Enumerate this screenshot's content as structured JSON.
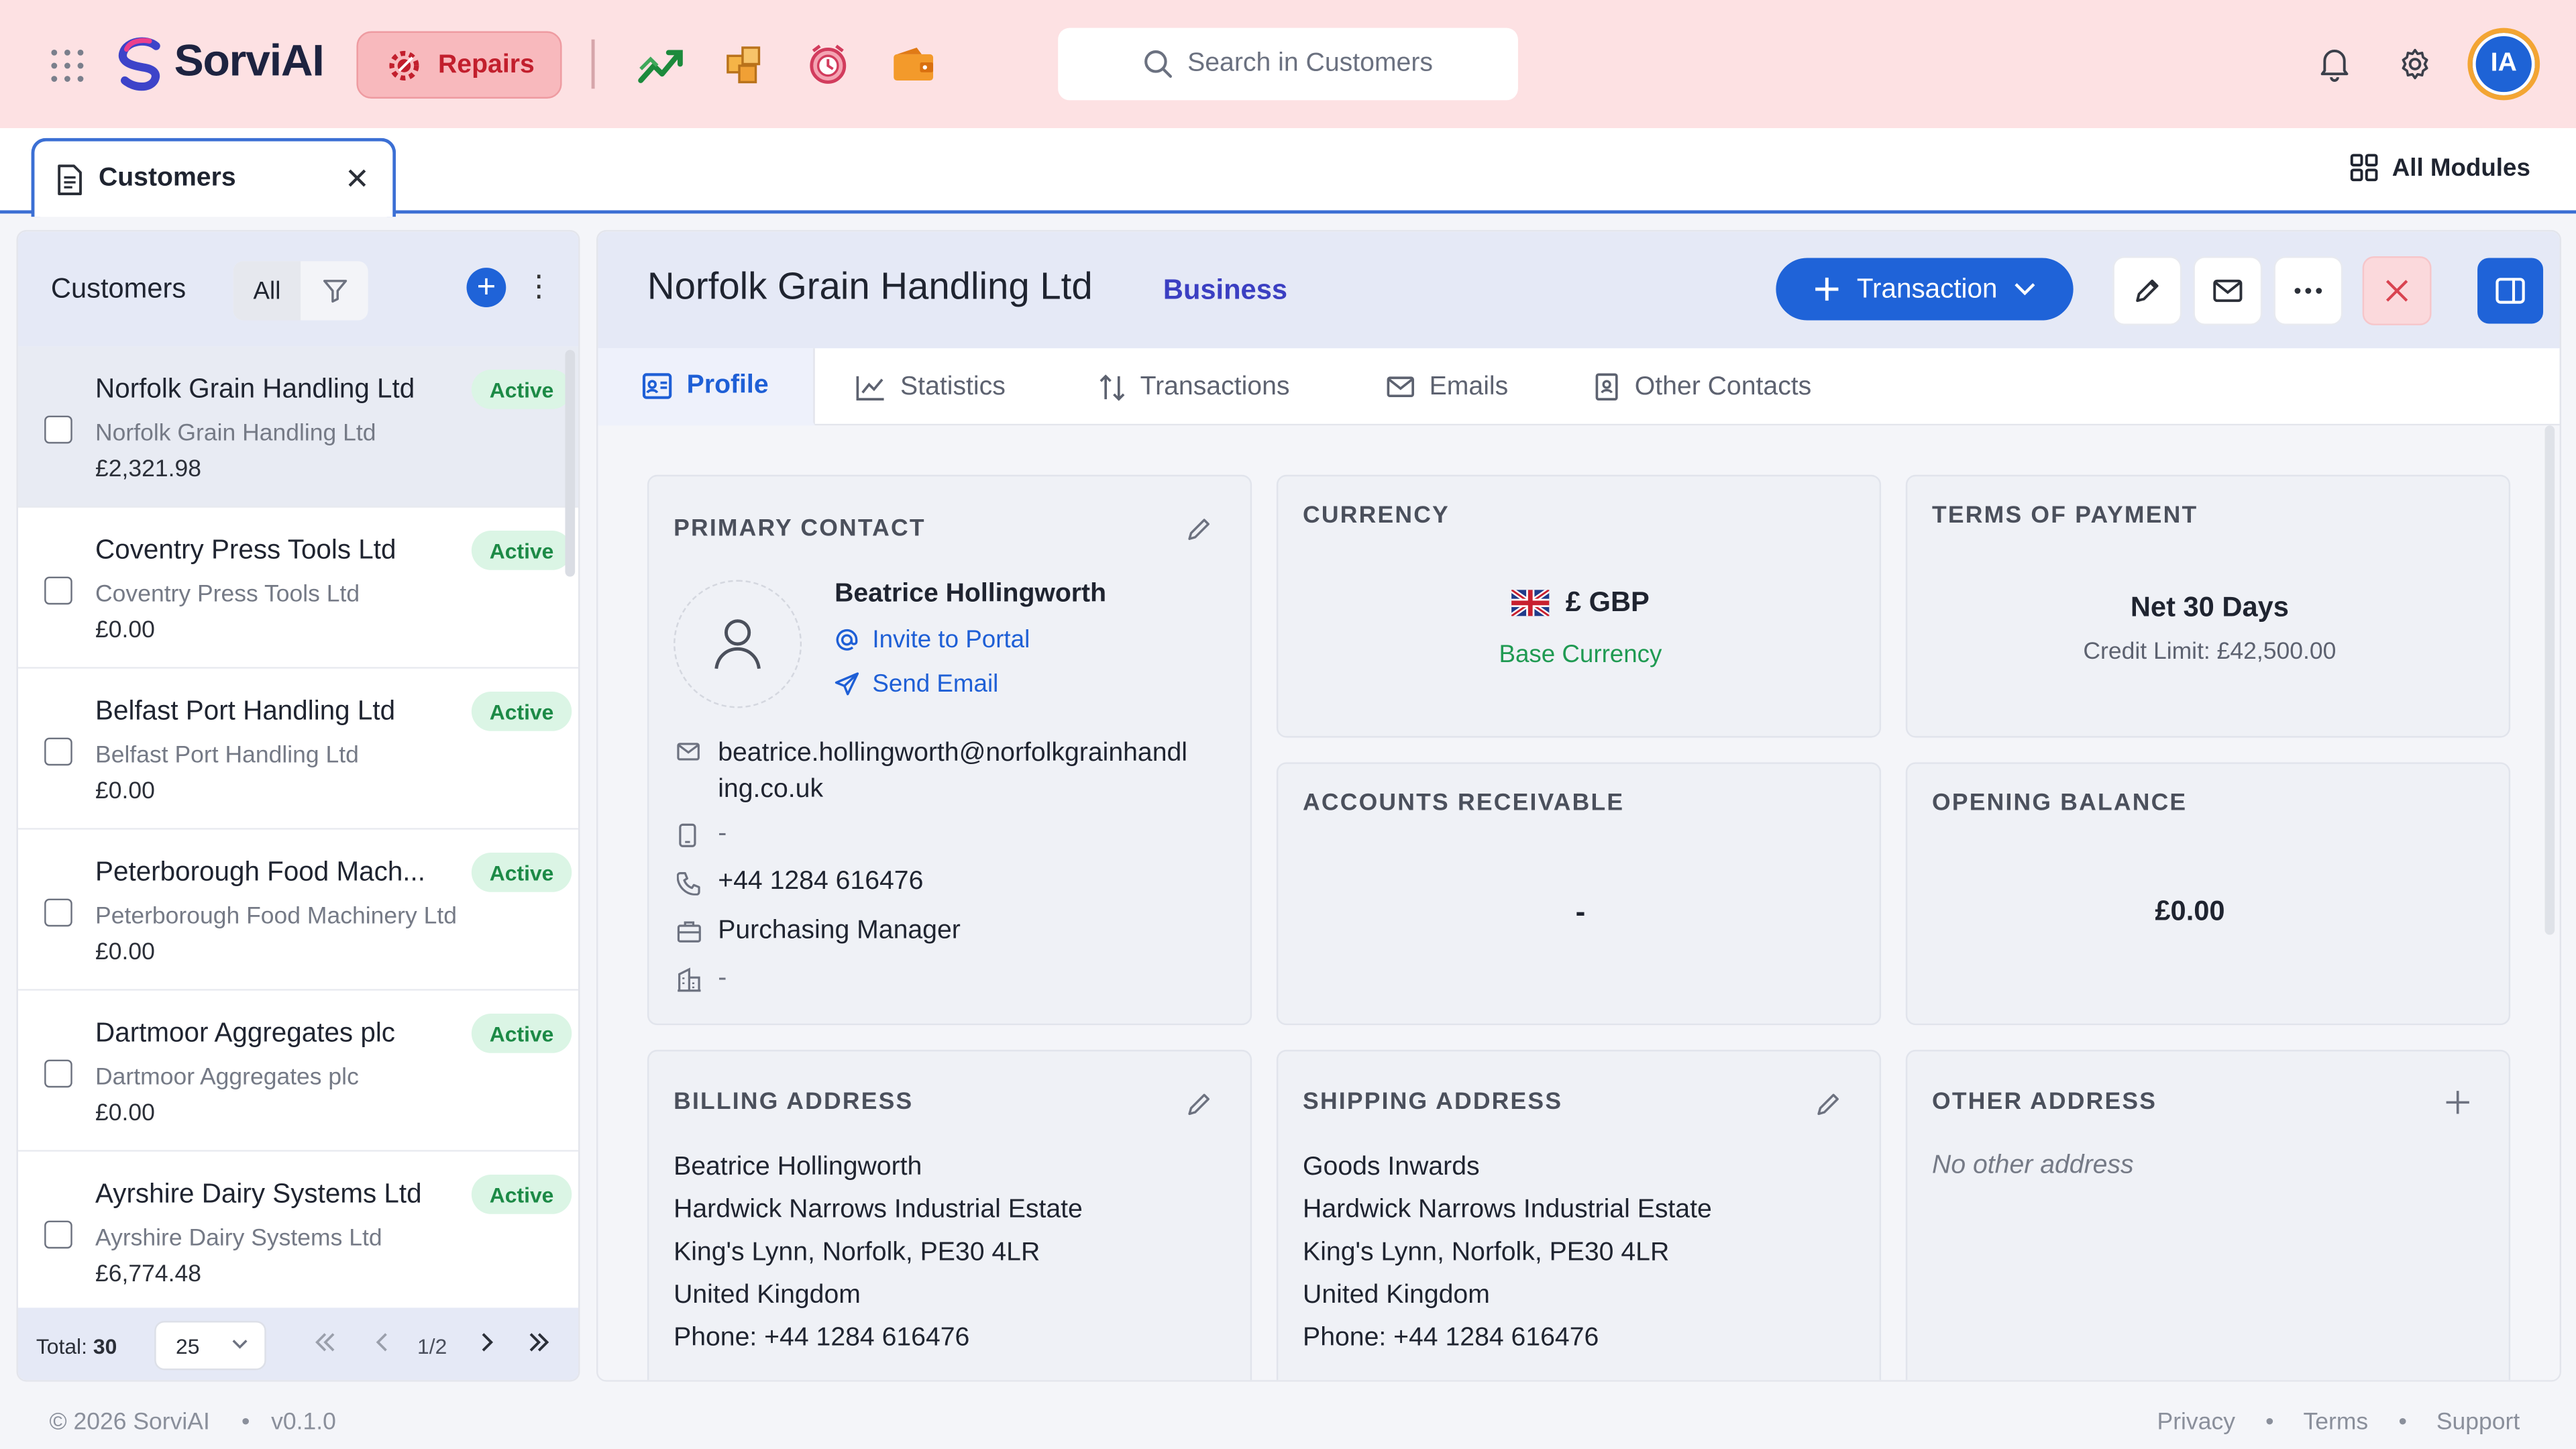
{
  "app": {
    "name": "SorviAI",
    "module_button": "Repairs",
    "search_placeholder": "Search in Customers",
    "user_initials": "IA",
    "brand_color": "#1f63d8",
    "accent_color": "#fde1e3"
  },
  "topbar_icons": [
    "apps-grid-icon",
    "growth-chart-icon",
    "boxes-icon",
    "alarm-clock-icon",
    "wallet-icon",
    "bell-icon",
    "gear-icon"
  ],
  "tabstrip": {
    "tab_label": "Customers",
    "all_modules": "All Modules"
  },
  "list": {
    "title": "Customers",
    "filter_all": "All",
    "items": [
      {
        "name": "Norfolk Grain Handling Ltd",
        "company": "Norfolk Grain Handling Ltd",
        "amount": "£2,321.98",
        "status": "Active"
      },
      {
        "name": "Coventry Press Tools Ltd",
        "company": "Coventry Press Tools Ltd",
        "amount": "£0.00",
        "status": "Active"
      },
      {
        "name": "Belfast Port Handling Ltd",
        "company": "Belfast Port Handling Ltd",
        "amount": "£0.00",
        "status": "Active"
      },
      {
        "name": "Peterborough Food Mach...",
        "company": "Peterborough Food Machinery Ltd",
        "amount": "£0.00",
        "status": "Active"
      },
      {
        "name": "Dartmoor Aggregates plc",
        "company": "Dartmoor Aggregates plc",
        "amount": "£0.00",
        "status": "Active"
      },
      {
        "name": "Ayrshire Dairy Systems Ltd",
        "company": "Ayrshire Dairy Systems Ltd",
        "amount": "£6,774.48",
        "status": "Active"
      }
    ],
    "footer": {
      "total_label": "Total:",
      "total_value": "30",
      "page_size": "25",
      "page_indicator": "1/2"
    }
  },
  "detail": {
    "title": "Norfolk Grain Handling Ltd",
    "type": "Business",
    "transaction_button": "Transaction",
    "tabs": [
      "Profile",
      "Statistics",
      "Transactions",
      "Emails",
      "Other Contacts"
    ],
    "primary_contact": {
      "heading": "PRIMARY CONTACT",
      "name": "Beatrice Hollingworth",
      "invite": "Invite to Portal",
      "send_email": "Send Email",
      "email_line1": "beatrice.hollingworth@norfolkgrainhandl",
      "email_line2": "ing.co.uk",
      "mobile": "-",
      "phone": "+44 1284 616476",
      "job_title": "Purchasing Manager",
      "department": "-"
    },
    "currency": {
      "heading": "CURRENCY",
      "value": "£ GBP",
      "note": "Base Currency"
    },
    "terms": {
      "heading": "TERMS OF PAYMENT",
      "value": "Net 30 Days",
      "credit_limit": "Credit Limit: £42,500.00"
    },
    "receivable": {
      "heading": "ACCOUNTS RECEIVABLE",
      "value": "-"
    },
    "opening_balance": {
      "heading": "OPENING BALANCE",
      "value": "£0.00"
    },
    "billing": {
      "heading": "BILLING ADDRESS",
      "lines": [
        "Beatrice Hollingworth",
        "Hardwick Narrows Industrial Estate",
        "King's Lynn, Norfolk, PE30 4LR",
        "United Kingdom",
        "Phone: +44 1284 616476"
      ]
    },
    "shipping": {
      "heading": "SHIPPING ADDRESS",
      "lines": [
        "Goods Inwards",
        "Hardwick Narrows Industrial Estate",
        "King's Lynn, Norfolk, PE30 4LR",
        "United Kingdom",
        "Phone: +44 1284 616476"
      ]
    },
    "other": {
      "heading": "OTHER ADDRESS",
      "empty": "No other address"
    }
  },
  "footer": {
    "copyright": "© 2026 SorviAI",
    "version": "v0.1.0",
    "links": [
      "Privacy",
      "Terms",
      "Support"
    ]
  }
}
